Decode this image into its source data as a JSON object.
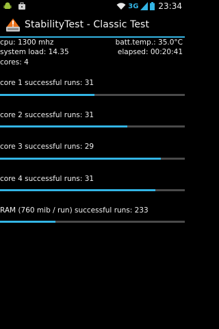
{
  "status_bar": {
    "network": "3G",
    "time": "23:34",
    "colors": {
      "accent": "#33b5e5"
    }
  },
  "app": {
    "title": "StabilityTest - Classic Test"
  },
  "info": {
    "cpu": "cpu: 1300 mhz",
    "batt_temp": "batt.temp.: 35.0°C",
    "system_load": "system load: 14.35",
    "elapsed": "elapsed: 00:20:41",
    "cores": "cores: 4"
  },
  "runs": [
    {
      "label": "core 1 successful runs: 31",
      "progress": 0.51
    },
    {
      "label": "core 2 successful runs: 31",
      "progress": 0.69
    },
    {
      "label": "core 3 successful runs: 29",
      "progress": 0.87
    },
    {
      "label": "core 4 successful runs: 31",
      "progress": 0.84
    },
    {
      "label": "RAM (760 mib / run) successful runs: 233",
      "progress": 0.3
    }
  ]
}
